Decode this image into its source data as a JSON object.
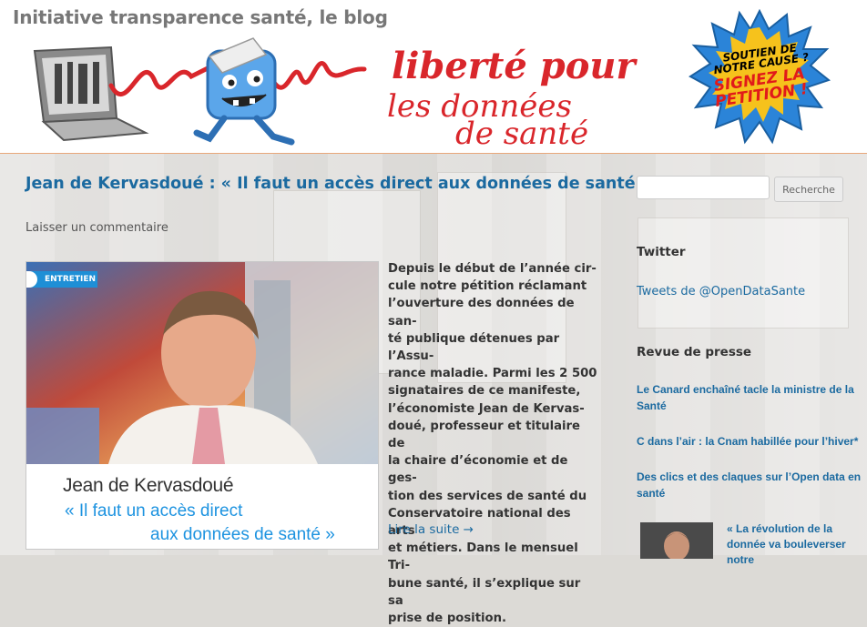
{
  "site": {
    "title": "Initiative transparence santé, le blog",
    "banner_alt": "liberté pour les données de santé"
  },
  "petition_badge": {
    "line1": "SOUTIEN DE NOTRE CAUSE ?",
    "line2": "SIGNEZ LA PETITION !"
  },
  "post": {
    "title": "Jean de Kervasdoué : « Il faut un accès direct aux données de santé »",
    "comment_link": "Laisser un commentaire",
    "image": {
      "tag": "ENTRETIEN",
      "name": "Jean de Kervasdoué",
      "quote_line1": "« Il faut un accès direct",
      "quote_line2": "aux données de santé »"
    },
    "excerpt_lines": [
      "Depuis le début de l’année cir-",
      "cule notre pétition réclamant",
      "l’ouverture des données de san-",
      "té publique détenues par l’Assu-",
      "rance maladie. Parmi les 2 500",
      "signataires de ce manifeste,",
      "l’économiste Jean de Kervas-",
      "doué, professeur et titulaire de",
      "la chaire d’économie et de ges-",
      "tion des services de santé du",
      "Conservatoire national des arts",
      "et métiers. Dans le mensuel Tri-",
      "bune santé, il s’explique sur sa",
      "prise de position."
    ],
    "read_more": "Lire la suite →"
  },
  "sidebar": {
    "search": {
      "placeholder": "",
      "button_label": "Recherche"
    },
    "twitter": {
      "title": "Twitter",
      "link": "Tweets de @OpenDataSante"
    },
    "press": {
      "title": "Revue de presse",
      "items": [
        "Le Canard enchaîné tacle la ministre de la Santé",
        "C dans l’air : la Cnam habillée pour l’hiver*",
        "Des clics et des claques sur l’Open data en santé",
        "« La révolution de la donnée va bouleverser notre"
      ]
    }
  },
  "colors": {
    "link": "#1b6aa0",
    "accent_orange": "#e8a77a",
    "banner_red": "#d9262b",
    "caption_blue": "#1d93e0"
  }
}
